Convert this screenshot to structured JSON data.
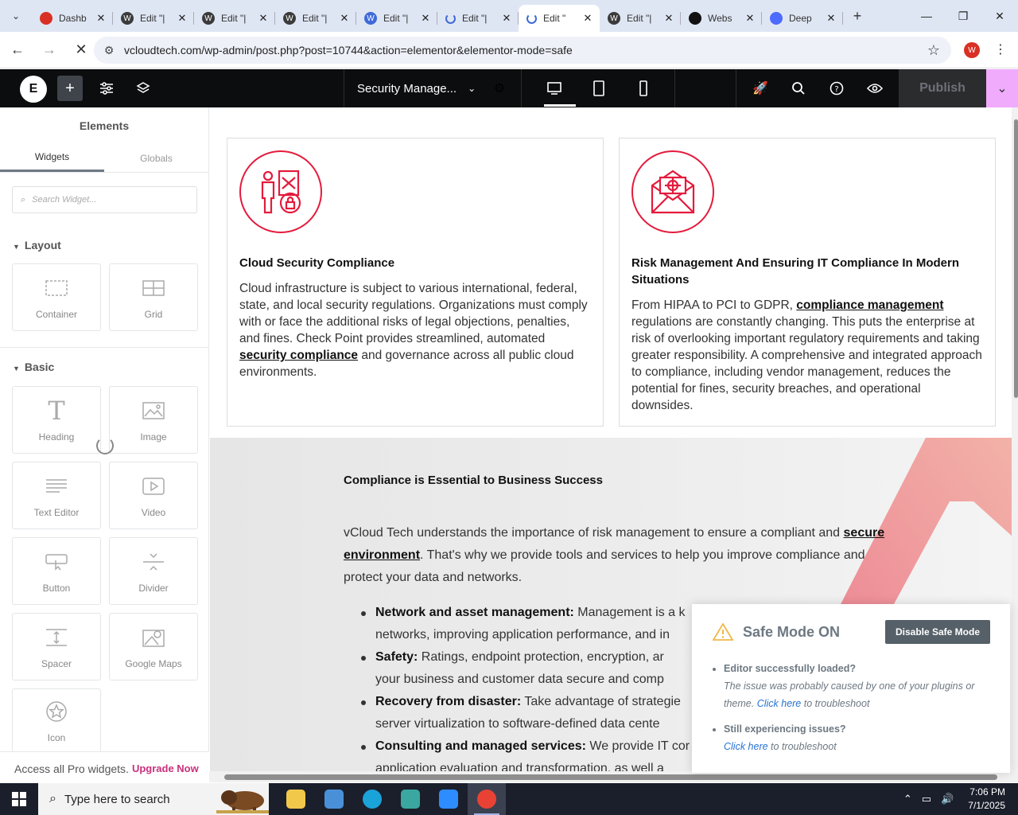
{
  "browser": {
    "tabs": [
      {
        "label": "Dashb",
        "icon_color": "#d93025",
        "icon": "diamond"
      },
      {
        "label": "Edit \"|",
        "icon_color": "#3b3b3b",
        "icon": "wordpress"
      },
      {
        "label": "Edit \"|",
        "icon_color": "#3b3b3b",
        "icon": "wordpress"
      },
      {
        "label": "Edit \"|",
        "icon_color": "#3b3b3b",
        "icon": "wordpress"
      },
      {
        "label": "Edit \"|",
        "icon_color": "#3f6ad8",
        "icon": "wordpress"
      },
      {
        "label": "Edit \"|",
        "icon_color": "#3f6ad8",
        "icon": "loading"
      },
      {
        "label": "Edit \"",
        "icon_color": "#3f6ad8",
        "icon": "loading"
      },
      {
        "label": "Edit \"|",
        "icon_color": "#3b3b3b",
        "icon": "wordpress"
      },
      {
        "label": "Webs",
        "icon_color": "#111111",
        "icon": "openai"
      },
      {
        "label": "Deep",
        "icon_color": "#4d6bfe",
        "icon": "deepseek"
      }
    ],
    "active_tab_index": 6,
    "url": "vcloudtech.com/wp-admin/post.php?post=10744&action=elementor&elementor-mode=safe",
    "profile_initial": "W"
  },
  "editor": {
    "document_name": "Security Manage...",
    "publish_label": "Publish"
  },
  "panel": {
    "title": "Elements",
    "tabs": [
      "Widgets",
      "Globals"
    ],
    "search_placeholder": "Search Widget...",
    "layout_section": "Layout",
    "basic_section": "Basic",
    "layout_widgets": [
      "Container",
      "Grid"
    ],
    "basic_widgets": [
      "Heading",
      "Image",
      "Text Editor",
      "Video",
      "Button",
      "Divider",
      "Spacer",
      "Google Maps",
      "Icon"
    ],
    "pro_text": "Access all Pro widgets.",
    "pro_link": "Upgrade Now"
  },
  "canvas": {
    "box1": {
      "title": "Cloud Security Compliance",
      "text_before": "Cloud infrastructure is subject to various international, federal, state, and local security regulations. Organizations must comply with or face the additional risks of legal objections, penalties, and fines. Check Point provides streamlined, automated ",
      "link": "security compliance",
      "text_after": " and governance across all public cloud environments."
    },
    "box2": {
      "title": "Risk Management And Ensuring IT Compliance In Modern Situations",
      "text_before": "From HIPAA to PCI to GDPR, ",
      "link": "compliance management",
      "text_after": " regulations are constantly changing. This puts the enterprise at risk of overlooking important regulatory requirements and taking greater responsibility. A comprehensive and integrated approach to compliance, including vendor management, reduces the potential for fines, security breaches, and operational downsides."
    },
    "section": {
      "title": "Compliance is Essential to Business Success",
      "para_before": "vCloud Tech understands the importance of risk management to ensure a compliant and ",
      "para_link": "secure environment",
      "para_after": ". That's why we provide tools and services to help you improve compliance and protect your data and networks.",
      "items": [
        {
          "label": "Network and asset management:",
          "text": " Management is a k"
        },
        {
          "label": "",
          "text": "networks, improving application performance, and in"
        },
        {
          "label": "Safety:",
          "text": " Ratings, endpoint protection, encryption, ar"
        },
        {
          "label": "",
          "text": "your business and customer data secure and comp"
        },
        {
          "label": "Recovery from disaster:",
          "text": " Take advantage of strategie"
        },
        {
          "label": "",
          "text": "server virtualization to software-defined data cente"
        },
        {
          "label": "Consulting and managed services:",
          "text": " We provide IT cor"
        },
        {
          "label": "",
          "text": "application evaluation and transformation, as well a"
        }
      ]
    }
  },
  "safe_mode": {
    "title": "Safe Mode ON",
    "button": "Disable Safe Mode",
    "q1": "Editor successfully loaded?",
    "a1_before": "The issue was probably caused by one of your plugins or theme. ",
    "a1_link": "Click here",
    "a1_after": " to troubleshoot",
    "q2": "Still experiencing issues?",
    "a2_link": "Click here",
    "a2_after": " to troubleshoot"
  },
  "taskbar": {
    "search_placeholder": "Type here to search",
    "time": "7:06 PM",
    "date": "7/1/2025",
    "apps": [
      {
        "name": "file-explorer",
        "color": "#f2c84b"
      },
      {
        "name": "app-bird",
        "color": "#4a90d9"
      },
      {
        "name": "edge",
        "color": "#1aa3d9"
      },
      {
        "name": "app-diamond",
        "color": "#3aa7a0"
      },
      {
        "name": "zoom",
        "color": "#2d8cff"
      },
      {
        "name": "chrome",
        "color": "#e94235"
      }
    ]
  },
  "colors": {
    "accent_red": "#e41b3c",
    "elementor_pink": "#f0abfc",
    "upgrade_pink": "#c9307c"
  }
}
